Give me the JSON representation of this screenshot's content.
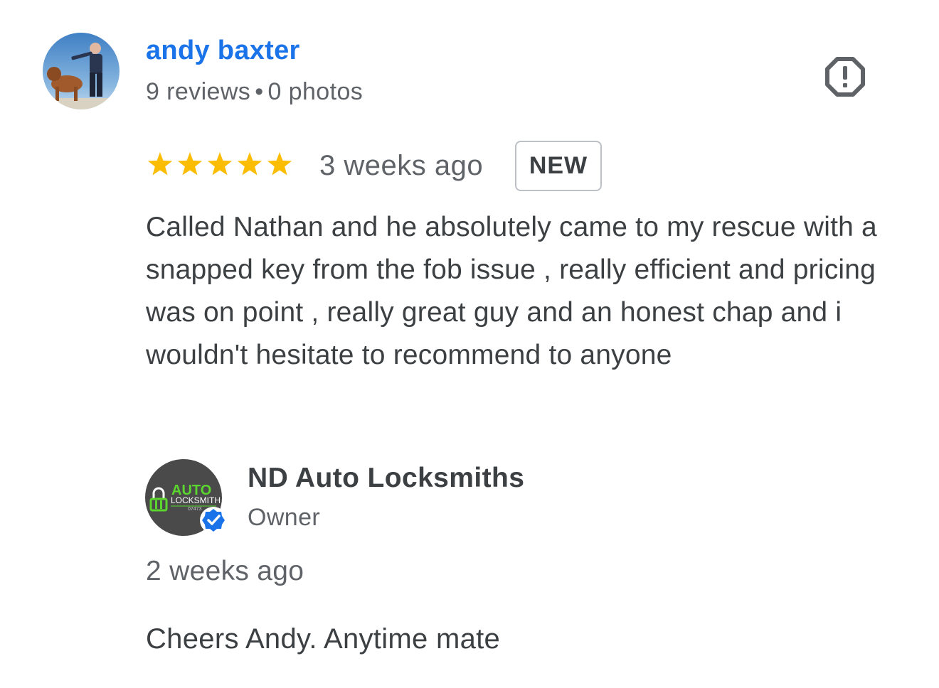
{
  "reviewer": {
    "name": "andy baxter",
    "reviews": "9 reviews",
    "separator": "•",
    "photos": "0 photos",
    "avatar_icon": "user-photo-avatar"
  },
  "report": {
    "icon": "report-flag-icon"
  },
  "review": {
    "rating": 5,
    "rating_max": 5,
    "star_color": "#fbbc04",
    "time": "3 weeks ago",
    "badge": "NEW",
    "text": "Called Nathan and he absolutely came to my rescue with a snapped key from the fob issue , really efficient and pricing was on point , really great guy and an honest chap and i wouldn't hesitate to recommend to anyone"
  },
  "owner": {
    "name": "ND Auto Locksmiths",
    "role": "Owner",
    "logo_text_1": "AUTO",
    "logo_text_2": "LOCKSMITH",
    "logo_text_3": "07473",
    "verified_icon": "verified-badge-icon",
    "reply_time": "2 weeks ago",
    "reply_text": "Cheers Andy. Anytime mate"
  },
  "colors": {
    "link_blue": "#1a73e8",
    "verified_blue": "#1a73e8",
    "logo_green": "#5bd62f",
    "logo_bg": "#4a4a4a"
  }
}
